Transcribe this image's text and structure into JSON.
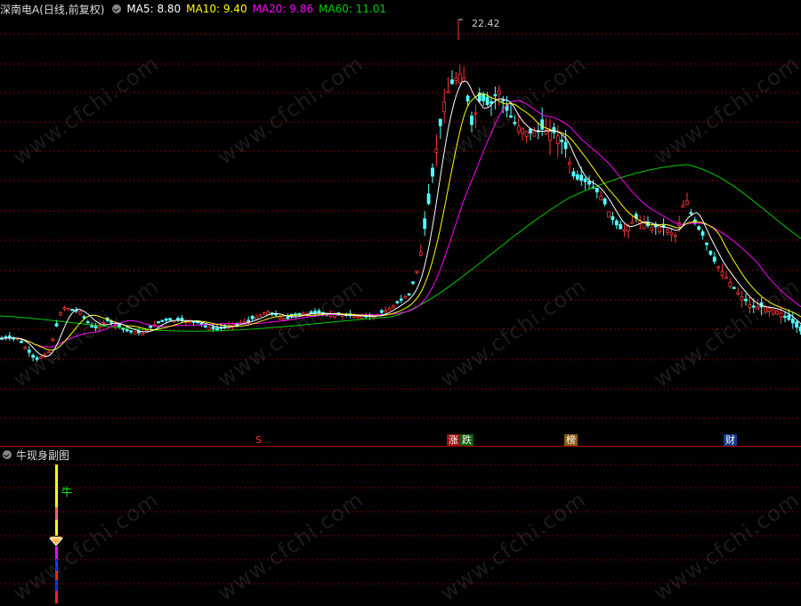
{
  "header": {
    "stock": "深南电A(日线,前复权)",
    "ma5": "MA5: 8.80",
    "ma10": "MA10: 9.40",
    "ma20": "MA20: 9.86",
    "ma60": "MA60: 11.01"
  },
  "colors": {
    "ma5": "#ffffff",
    "ma10": "#ffff00",
    "ma20": "#ff00ff",
    "ma60": "#00cc00",
    "up": "#ff3333",
    "down": "#54ffff",
    "grid": "#7a0000"
  },
  "peak_label": "22.42",
  "events": [
    {
      "label": "S",
      "color": "#ff3030",
      "bg": "none"
    },
    {
      "label": "涨",
      "color": "#ffffff",
      "bg": "#a01010"
    },
    {
      "label": "跌",
      "color": "#ffffff",
      "bg": "#106010"
    },
    {
      "label": "榜",
      "color": "#ffffff",
      "bg": "#8a5a10"
    },
    {
      "label": "财",
      "color": "#ffffff",
      "bg": "#103a8a"
    }
  ],
  "sub_panel": {
    "title": "牛现身副图",
    "signal_label": "牛"
  },
  "watermark": "www.cfchi.com",
  "chart_data": {
    "type": "candlestick",
    "peak": 22.42,
    "ma": {
      "MA5": 8.8,
      "MA10": 9.4,
      "MA20": 9.86,
      "MA60": 11.01
    }
  }
}
